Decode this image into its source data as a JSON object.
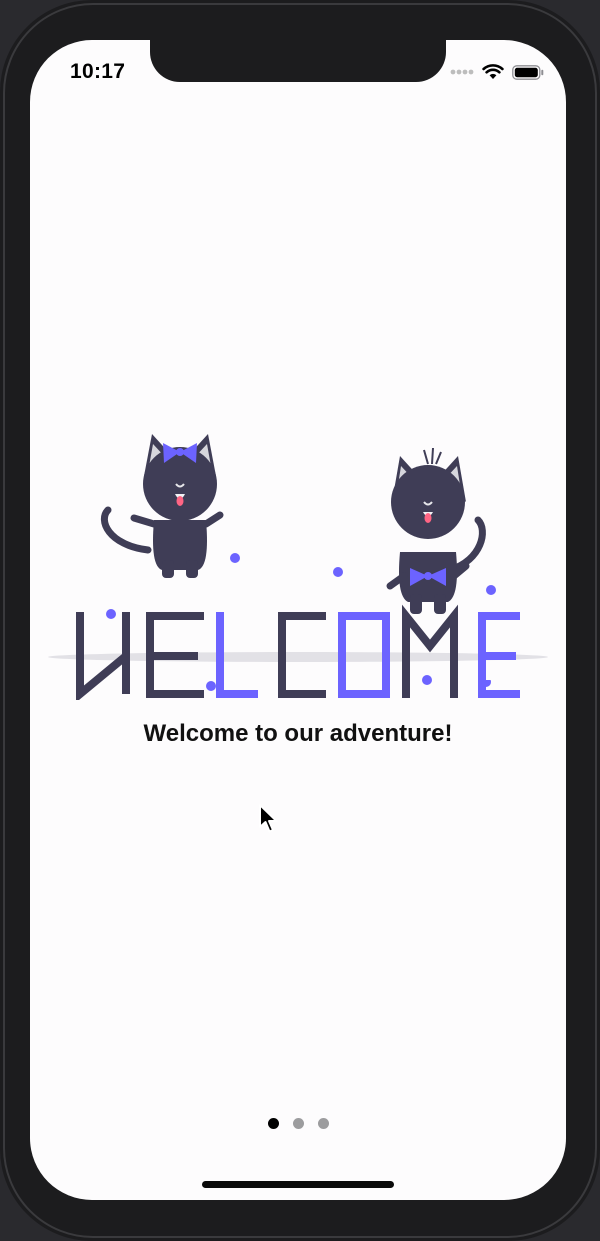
{
  "status_bar": {
    "time": "10:17",
    "icons": [
      "cellular-signal-icon",
      "wifi-icon",
      "battery-icon"
    ]
  },
  "onboarding": {
    "illustration": "welcome-cats-illustration",
    "illustration_word": "WELCOME",
    "headline": "Welcome to our adventure!",
    "page_indicator": {
      "pages": 3,
      "current": 1
    }
  },
  "colors": {
    "accent": "#6c63ff",
    "dark": "#3f3d56",
    "background": "#fdfcfd"
  }
}
